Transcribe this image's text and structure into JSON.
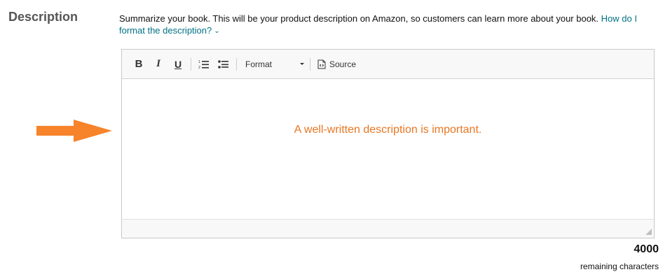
{
  "section": {
    "label": "Description"
  },
  "help": {
    "text": "Summarize your book. This will be your product description on Amazon, so customers can learn more about your book.",
    "link_text": "How do I format the description?"
  },
  "toolbar": {
    "bold_label": "B",
    "italic_label": "I",
    "underline_label": "U",
    "format_label": "Format",
    "source_label": "Source"
  },
  "editor": {
    "content": "A well-written description is important."
  },
  "counter": {
    "value": "4000",
    "label": "remaining characters"
  },
  "colors": {
    "accent_orange": "#e87722",
    "link": "#007185",
    "label_gray": "#555555"
  },
  "icons": {
    "numbered_list": "numbered-list-icon",
    "bulleted_list": "bulleted-list-icon",
    "source": "source-icon",
    "chevron": "chevron-down-icon",
    "arrow": "arrow-right-icon",
    "resize": "resize-grip-icon"
  }
}
